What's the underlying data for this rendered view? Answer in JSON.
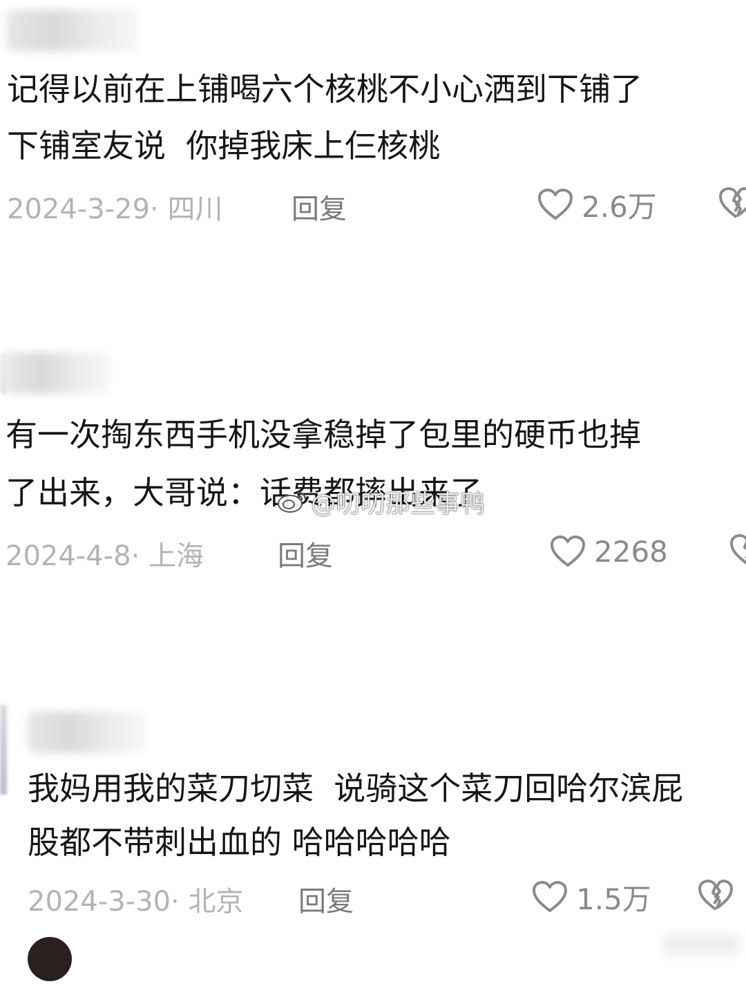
{
  "comments": [
    {
      "text_lines": [
        "记得以前在上铺喝六个核桃不小心洒到下铺了",
        "下铺室友说  你掉我床上仨核桃"
      ],
      "meta": "2024-3-29· 四川",
      "reply_label": "回复",
      "likes": "2.6万"
    },
    {
      "text_lines": [
        "有一次掏东西手机没拿稳掉了包里的硬币也掉",
        "了出来，大哥说：话费都摔出来了"
      ],
      "meta": "2024-4-8· 上海",
      "reply_label": "回复",
      "likes": "2268"
    },
    {
      "text_lines": [
        "我妈用我的菜刀切菜  说骑这个菜刀回哈尔滨屁",
        "股都不带刺出血的 哈哈哈哈哈"
      ],
      "meta": "2024-3-30· 北京",
      "reply_label": "回复",
      "likes": "1.5万"
    }
  ],
  "watermark": "@叨叨那些事鸭",
  "icons": {
    "like": "heart-outline-icon",
    "dislike": "broken-heart-icon",
    "watermark_logo": "weibo-logo-icon"
  },
  "colors": {
    "text": "#161616",
    "meta": "#b3b3b3",
    "reply": "#7a7a7a",
    "icon": "#8a8a8a"
  }
}
